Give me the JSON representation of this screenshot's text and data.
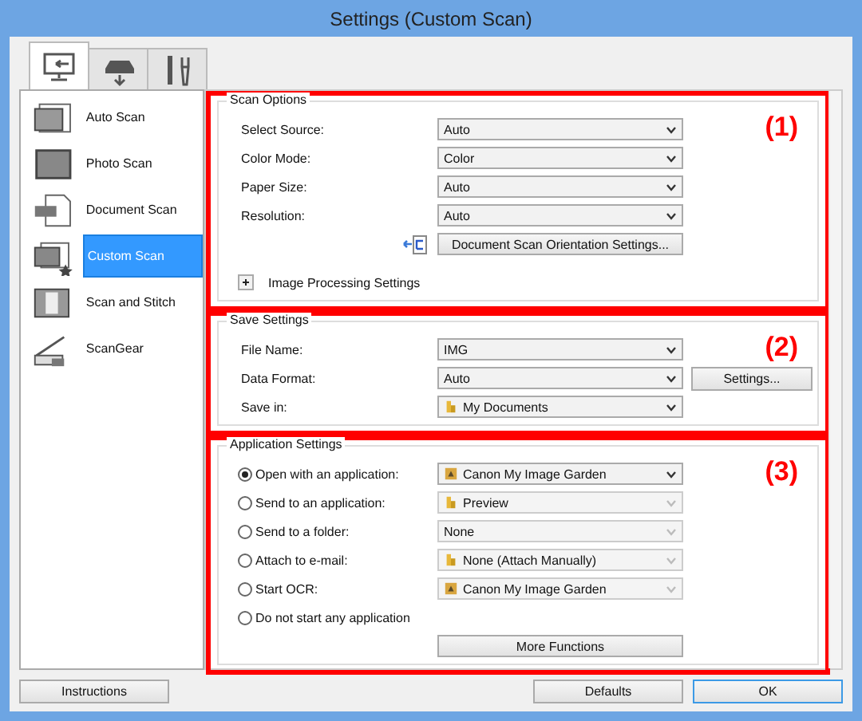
{
  "window": {
    "title": "Settings (Custom Scan)"
  },
  "tabs": [
    {
      "kind": "scan-computer",
      "selected": true
    },
    {
      "kind": "scanner",
      "selected": false
    },
    {
      "kind": "tools",
      "selected": false
    }
  ],
  "sidebar": {
    "items": [
      {
        "label": "Auto Scan",
        "kind": "auto",
        "selected": false
      },
      {
        "label": "Photo Scan",
        "kind": "photo",
        "selected": false
      },
      {
        "label": "Document Scan",
        "kind": "document",
        "selected": false
      },
      {
        "label": "Custom Scan",
        "kind": "custom",
        "selected": true
      },
      {
        "label": "Scan and Stitch",
        "kind": "stitch",
        "selected": false
      },
      {
        "label": "ScanGear",
        "kind": "scangear",
        "selected": false
      }
    ]
  },
  "sections": [
    {
      "title": "Scan Options",
      "callout": "(1)",
      "rows": [
        {
          "kind": "select",
          "label": "Select Source:",
          "value": "Auto",
          "disabled": false
        },
        {
          "kind": "select",
          "label": "Color Mode:",
          "value": "Color",
          "disabled": false
        },
        {
          "kind": "select",
          "label": "Paper Size:",
          "value": "Auto",
          "disabled": false
        },
        {
          "kind": "select",
          "label": "Resolution:",
          "value": "Auto",
          "disabled": false
        },
        {
          "kind": "button",
          "label": "Document Scan Orientation Settings..."
        },
        {
          "kind": "expander",
          "label": "Image Processing Settings",
          "expanded": false
        }
      ]
    },
    {
      "title": "Save Settings",
      "callout": "(2)",
      "rows": [
        {
          "kind": "select",
          "label": "File Name:",
          "value": "IMG",
          "disabled": false
        },
        {
          "kind": "select",
          "label": "Data Format:",
          "value": "Auto",
          "disabled": false,
          "side_button": "Settings..."
        },
        {
          "kind": "select",
          "label": "Save in:",
          "value": "My Documents",
          "value_icon": {
            "kind": "folder"
          },
          "disabled": false
        }
      ]
    },
    {
      "title": "Application Settings",
      "callout": "(3)",
      "rows": [
        {
          "kind": "radio",
          "label": "Open with an application:",
          "selected": true,
          "value": "Canon My Image Garden",
          "value_icon": {
            "kind": "app"
          },
          "disabled": false
        },
        {
          "kind": "radio",
          "label": "Send to an application:",
          "selected": false,
          "value": "Preview",
          "value_icon": {
            "kind": "folder"
          },
          "disabled": true
        },
        {
          "kind": "radio",
          "label": "Send to a folder:",
          "selected": false,
          "value": "None",
          "disabled": true
        },
        {
          "kind": "radio",
          "label": "Attach to e-mail:",
          "selected": false,
          "value": "None (Attach Manually)",
          "value_icon": {
            "kind": "folder"
          },
          "disabled": true
        },
        {
          "kind": "radio",
          "label": "Start OCR:",
          "selected": false,
          "value": "Canon My Image Garden",
          "value_icon": {
            "kind": "app"
          },
          "disabled": true
        },
        {
          "kind": "radio",
          "label": "Do not start any application",
          "selected": false
        },
        {
          "kind": "button",
          "label": "More Functions"
        }
      ]
    }
  ],
  "footer": {
    "buttons": [
      {
        "label": "Instructions",
        "default": false
      },
      {
        "label": "Defaults",
        "default": false
      },
      {
        "label": "OK",
        "default": true
      }
    ]
  }
}
